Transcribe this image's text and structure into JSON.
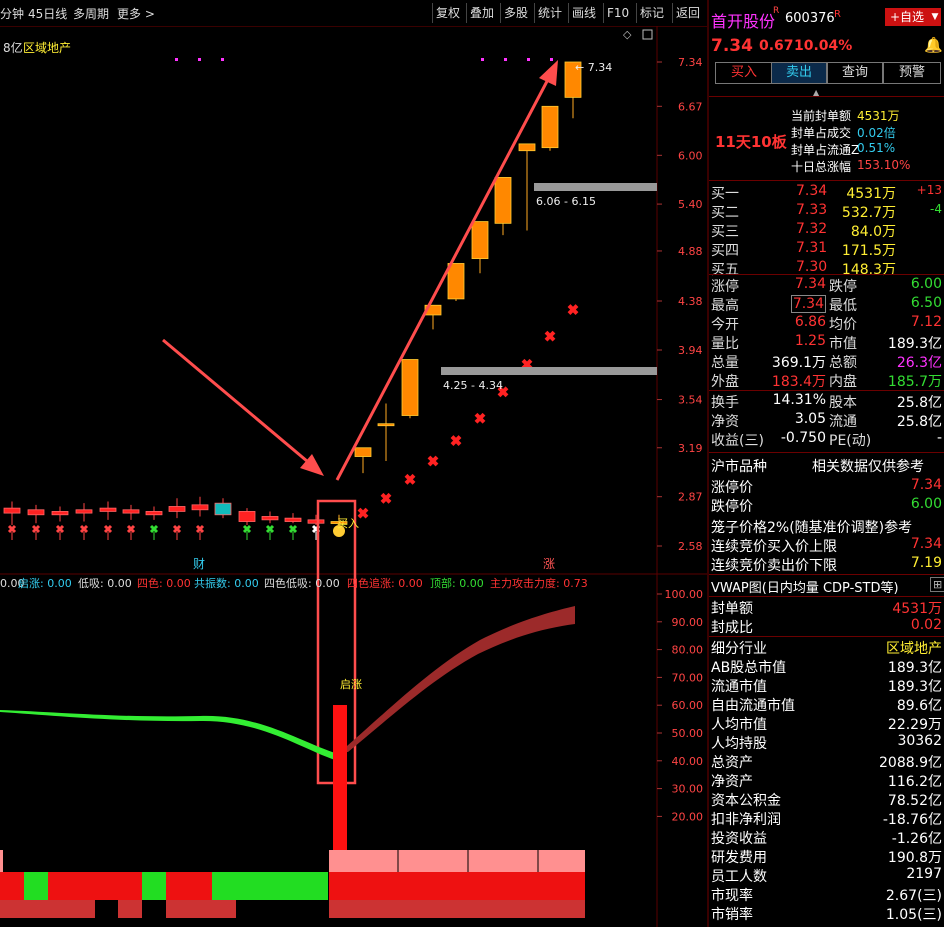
{
  "toolbar": {
    "left": [
      "分钟",
      "45日线",
      "多周期",
      "更多 >"
    ],
    "right": [
      "复权",
      "叠加",
      "多股",
      "统计",
      "画线",
      "F10",
      "标记",
      "返回"
    ]
  },
  "chart_header": {
    "prefix": "8亿",
    "sector": "区域地产"
  },
  "price_axis": [
    "7.34",
    "6.67",
    "6.00",
    "5.40",
    "4.88",
    "4.38",
    "3.94",
    "3.54",
    "3.19",
    "2.87",
    "2.58"
  ],
  "chart_annotations": {
    "peak": "← 7.34",
    "zone_high": "6.06 - 6.15",
    "zone_low": "4.25 - 4.34",
    "buy_label": "买入",
    "cai": "财",
    "zhang": "涨",
    "qizhang": "启涨"
  },
  "indicator_bar": [
    {
      "label": "0.00",
      "color": "#dddddd"
    },
    {
      "label": "启涨: 0.00",
      "color": "#33ccee"
    },
    {
      "label": "低吸: 0.00",
      "color": "#dddddd"
    },
    {
      "label": "四色: 0.00",
      "color": "#ff3333"
    },
    {
      "label": "共振数: 0.00",
      "color": "#33ccee"
    },
    {
      "label": "四色低吸: 0.00",
      "color": "#dddddd"
    },
    {
      "label": "四色追涨: 0.00",
      "color": "#ff3333"
    },
    {
      "label": "顶部: 0.00",
      "color": "#33dd33"
    },
    {
      "label": "主力攻击力度: 0.73",
      "color": "#ff3333"
    }
  ],
  "osc_axis": [
    "100.00",
    "90.00",
    "80.00",
    "70.00",
    "60.00",
    "50.00",
    "40.00",
    "30.00",
    "20.00"
  ],
  "candles": [
    {
      "o": 2.8,
      "h": 2.84,
      "l": 2.7,
      "c": 2.77
    },
    {
      "o": 2.79,
      "h": 2.82,
      "l": 2.71,
      "c": 2.76
    },
    {
      "o": 2.78,
      "h": 2.81,
      "l": 2.72,
      "c": 2.76
    },
    {
      "o": 2.79,
      "h": 2.83,
      "l": 2.72,
      "c": 2.77
    },
    {
      "o": 2.8,
      "h": 2.84,
      "l": 2.73,
      "c": 2.78
    },
    {
      "o": 2.79,
      "h": 2.82,
      "l": 2.73,
      "c": 2.77
    },
    {
      "o": 2.78,
      "h": 2.81,
      "l": 2.73,
      "c": 2.76
    },
    {
      "o": 2.81,
      "h": 2.86,
      "l": 2.74,
      "c": 2.78
    },
    {
      "o": 2.82,
      "h": 2.87,
      "l": 2.75,
      "c": 2.79
    },
    {
      "o": 2.83,
      "h": 2.86,
      "l": 2.74,
      "c": 2.76
    },
    {
      "o": 2.78,
      "h": 2.8,
      "l": 2.7,
      "c": 2.72
    },
    {
      "o": 2.75,
      "h": 2.78,
      "l": 2.71,
      "c": 2.73
    },
    {
      "o": 2.74,
      "h": 2.77,
      "l": 2.71,
      "c": 2.72
    },
    {
      "o": 2.73,
      "h": 2.76,
      "l": 2.7,
      "c": 2.71
    },
    {
      "o": 2.72,
      "h": 2.76,
      "l": 2.7,
      "c": 2.72
    },
    {
      "o": 3.13,
      "h": 3.19,
      "l": 3.02,
      "c": 3.19
    },
    {
      "o": 3.36,
      "h": 3.51,
      "l": 3.1,
      "c": 3.36
    },
    {
      "o": 3.42,
      "h": 3.86,
      "l": 3.4,
      "c": 3.86
    },
    {
      "o": 4.25,
      "h": 4.34,
      "l": 4.12,
      "c": 4.34
    },
    {
      "o": 4.4,
      "h": 4.75,
      "l": 4.38,
      "c": 4.75
    },
    {
      "o": 4.8,
      "h": 5.2,
      "l": 4.65,
      "c": 5.2
    },
    {
      "o": 5.18,
      "h": 5.72,
      "l": 5.05,
      "c": 5.72
    },
    {
      "o": 6.06,
      "h": 6.15,
      "l": 5.1,
      "c": 6.15
    },
    {
      "o": 6.1,
      "h": 6.67,
      "l": 6.06,
      "c": 6.67
    },
    {
      "o": 6.8,
      "h": 7.34,
      "l": 6.5,
      "c": 7.34
    }
  ],
  "stops": [
    2.77,
    2.86,
    2.98,
    3.1,
    3.24,
    3.4,
    3.6,
    3.82,
    4.06,
    4.3
  ],
  "right_panel": {
    "name": "首开股份",
    "name_tag": "R",
    "code": "600376",
    "flag": "R",
    "add_btn": "+自选",
    "price": "7.34",
    "change": "0.67",
    "pct": "10.04%",
    "buttons": [
      "买入",
      "卖出",
      "查询",
      "预警"
    ],
    "board": "11天10板",
    "seal": [
      {
        "k": "当前封单额",
        "v": "4531万"
      },
      {
        "k": "封单占成交",
        "v": "0.02倍"
      },
      {
        "k": "封单占流通Z",
        "v": "0.51%"
      },
      {
        "k": "十日总涨幅",
        "v": "153.10%"
      }
    ],
    "bids": [
      {
        "k": "买一",
        "p": "7.34",
        "v": "4531万",
        "d": "+13"
      },
      {
        "k": "买二",
        "p": "7.33",
        "v": "532.7万",
        "d": "-4"
      },
      {
        "k": "买三",
        "p": "7.32",
        "v": "84.0万",
        "d": ""
      },
      {
        "k": "买四",
        "p": "7.31",
        "v": "171.5万",
        "d": ""
      },
      {
        "k": "买五",
        "p": "7.30",
        "v": "148.3万",
        "d": ""
      }
    ],
    "stats": [
      {
        "k1": "涨停",
        "v1": "7.34",
        "k2": "跌停",
        "v2": "6.00"
      },
      {
        "k1": "最高",
        "v1": "7.34",
        "k2": "最低",
        "v2": "6.50"
      },
      {
        "k1": "今开",
        "v1": "6.86",
        "k2": "均价",
        "v2": "7.12"
      },
      {
        "k1": "量比",
        "v1": "1.25",
        "k2": "市值",
        "v2": "189.3亿"
      },
      {
        "k1": "总量",
        "v1": "369.1万",
        "k2": "总额",
        "v2": "26.3亿"
      },
      {
        "k1": "外盘",
        "v1": "183.4万",
        "k2": "内盘",
        "v2": "185.7万"
      }
    ],
    "stats2": [
      {
        "k1": "换手",
        "v1": "14.31%",
        "k2": "股本",
        "v2": "25.8亿"
      },
      {
        "k1": "净资",
        "v1": "3.05",
        "k2": "流通",
        "v2": "25.8亿"
      },
      {
        "k1": "收益(三)",
        "v1": "-0.750",
        "k2": "PE(动)",
        "v2": "-"
      }
    ],
    "market_hdr": "沪市品种",
    "market_hdr2": "相关数据仅供参考",
    "limits": [
      {
        "k": "涨停价",
        "v": "7.34"
      },
      {
        "k": "跌停价",
        "v": "6.00"
      }
    ],
    "cage": "笼子价格2%(随基准价调整)参考",
    "auction": [
      {
        "k": "连续竞价买入价上限",
        "v": "7.34"
      },
      {
        "k": "连续竞价卖出价下限",
        "v": "7.19"
      }
    ],
    "vwap": "VWAP图(日内均量 CDP-STD等)",
    "fund": [
      {
        "k": "封单额",
        "v": "4531万"
      },
      {
        "k": "封成比",
        "v": "0.02"
      }
    ],
    "info": [
      {
        "k": "细分行业",
        "v": "区域地产"
      },
      {
        "k": "AB股总市值",
        "v": "189.3亿"
      },
      {
        "k": "流通市值",
        "v": "189.3亿"
      },
      {
        "k": "自由流通市值",
        "v": "89.6亿"
      },
      {
        "k": "人均市值",
        "v": "22.29万"
      },
      {
        "k": "人均持股",
        "v": "30362"
      },
      {
        "k": "总资产",
        "v": "2088.9亿"
      },
      {
        "k": "净资产",
        "v": "116.2亿"
      },
      {
        "k": "资本公积金",
        "v": "78.52亿"
      },
      {
        "k": "扣非净利润",
        "v": "-18.76亿"
      },
      {
        "k": "投资收益",
        "v": "-1.26亿"
      },
      {
        "k": "研发费用",
        "v": "190.8万"
      },
      {
        "k": "员工人数",
        "v": "2197"
      },
      {
        "k": "市现率",
        "v": "2.67(三)"
      },
      {
        "k": "市销率",
        "v": "1.05(三)"
      }
    ]
  }
}
